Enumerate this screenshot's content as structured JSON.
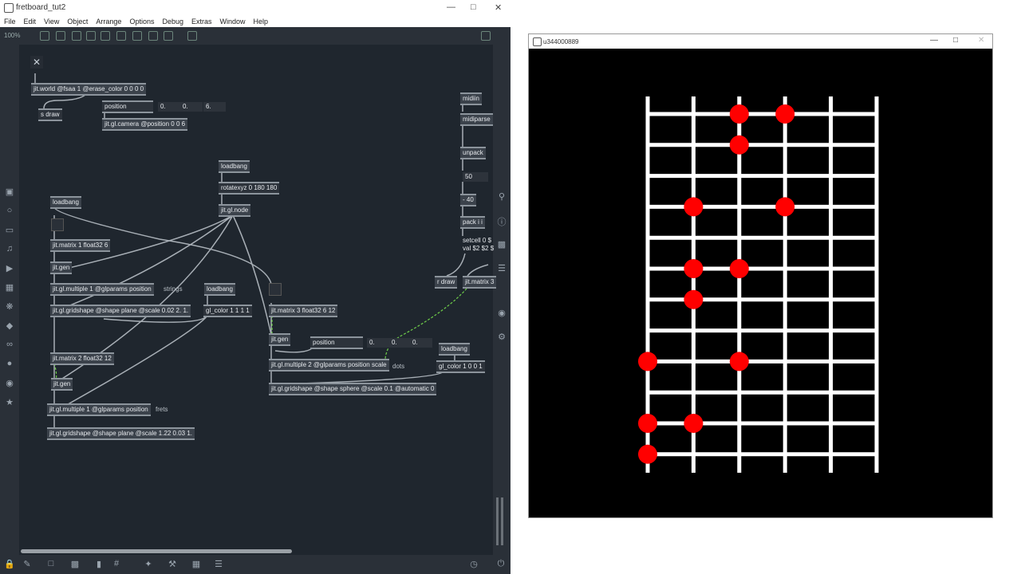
{
  "max": {
    "title": "fretboard_tut2",
    "menu": [
      "File",
      "Edit",
      "View",
      "Object",
      "Arrange",
      "Options",
      "Debug",
      "Extras",
      "Window",
      "Help"
    ],
    "zoom": "100%",
    "objects": [
      {
        "id": "o1",
        "text": "jit.world @fsaa 1 @erase_color 0 0 0 0"
      },
      {
        "id": "o2",
        "text": "s draw"
      },
      {
        "id": "o3",
        "text": "position"
      },
      {
        "id": "o4",
        "text": "jit.gl.camera @position 0 0 6"
      },
      {
        "id": "o5",
        "text": "loadbang"
      },
      {
        "id": "o6",
        "text": "rotatexyz 0 180 180"
      },
      {
        "id": "o7",
        "text": "jit.gl.node"
      },
      {
        "id": "o8",
        "text": "loadbang"
      },
      {
        "id": "o9",
        "text": "jit.matrix 1 float32 6"
      },
      {
        "id": "o10",
        "text": "jit.gen"
      },
      {
        "id": "o11",
        "text": "jit.gl.multiple 1 @glparams position"
      },
      {
        "id": "o12",
        "text": "loadbang"
      },
      {
        "id": "o13",
        "text": "jit.gl.gridshape @shape plane @scale 0.02 2. 1."
      },
      {
        "id": "o14",
        "text": "gl_color 1 1 1 1"
      },
      {
        "id": "o15",
        "text": "jit.matrix 3 float32 6 12"
      },
      {
        "id": "o16",
        "text": "jit.gen"
      },
      {
        "id": "o17",
        "text": "position"
      },
      {
        "id": "o18",
        "text": "jit.matrix 2 float32 12"
      },
      {
        "id": "o19",
        "text": "jit.gl.multiple 2 @glparams position scale"
      },
      {
        "id": "o20",
        "text": "loadbang"
      },
      {
        "id": "o21",
        "text": "jit.gen"
      },
      {
        "id": "o22",
        "text": "gl_color 1 0 0 1"
      },
      {
        "id": "o23",
        "text": "jit.gl.gridshape @shape sphere @scale 0.1 @automatic 0"
      },
      {
        "id": "o24",
        "text": "jit.gl.multiple 1 @glparams position"
      },
      {
        "id": "o25",
        "text": "jit.gl.gridshape @shape plane @scale 1.22 0.03 1."
      },
      {
        "id": "o26",
        "text": "midiin"
      },
      {
        "id": "o27",
        "text": "midiparse"
      },
      {
        "id": "o28",
        "text": "unpack"
      },
      {
        "id": "o29",
        "text": "50"
      },
      {
        "id": "o30",
        "text": "- 40"
      },
      {
        "id": "o31",
        "text": "pack i i"
      },
      {
        "id": "o32",
        "text": "setcell 0 $"
      },
      {
        "id": "o33",
        "text": "val $2 $2 $"
      },
      {
        "id": "o34",
        "text": "r draw"
      },
      {
        "id": "o35",
        "text": "jit.matrix 3"
      }
    ],
    "numbers": {
      "camera_pos": [
        "0.",
        "0.",
        "6."
      ],
      "sphere_pos": [
        "0.",
        "0.",
        "0."
      ]
    },
    "comments": {
      "strings": "strings",
      "dots": "dots",
      "frets": "frets"
    }
  },
  "jit": {
    "title": "u344000889",
    "strings": 6,
    "frets": 12,
    "dots": [
      {
        "string": 3,
        "fret": 1
      },
      {
        "string": 4,
        "fret": 1
      },
      {
        "string": 3,
        "fret": 2
      },
      {
        "string": 2,
        "fret": 4
      },
      {
        "string": 4,
        "fret": 4
      },
      {
        "string": 2,
        "fret": 6
      },
      {
        "string": 3,
        "fret": 6
      },
      {
        "string": 2,
        "fret": 7
      },
      {
        "string": 1,
        "fret": 9
      },
      {
        "string": 3,
        "fret": 9
      },
      {
        "string": 1,
        "fret": 11
      },
      {
        "string": 2,
        "fret": 11
      },
      {
        "string": 1,
        "fret": 12
      }
    ],
    "colors": {
      "grid": "#ffffff",
      "dot": "#ff0000",
      "bg": "#000000"
    }
  }
}
